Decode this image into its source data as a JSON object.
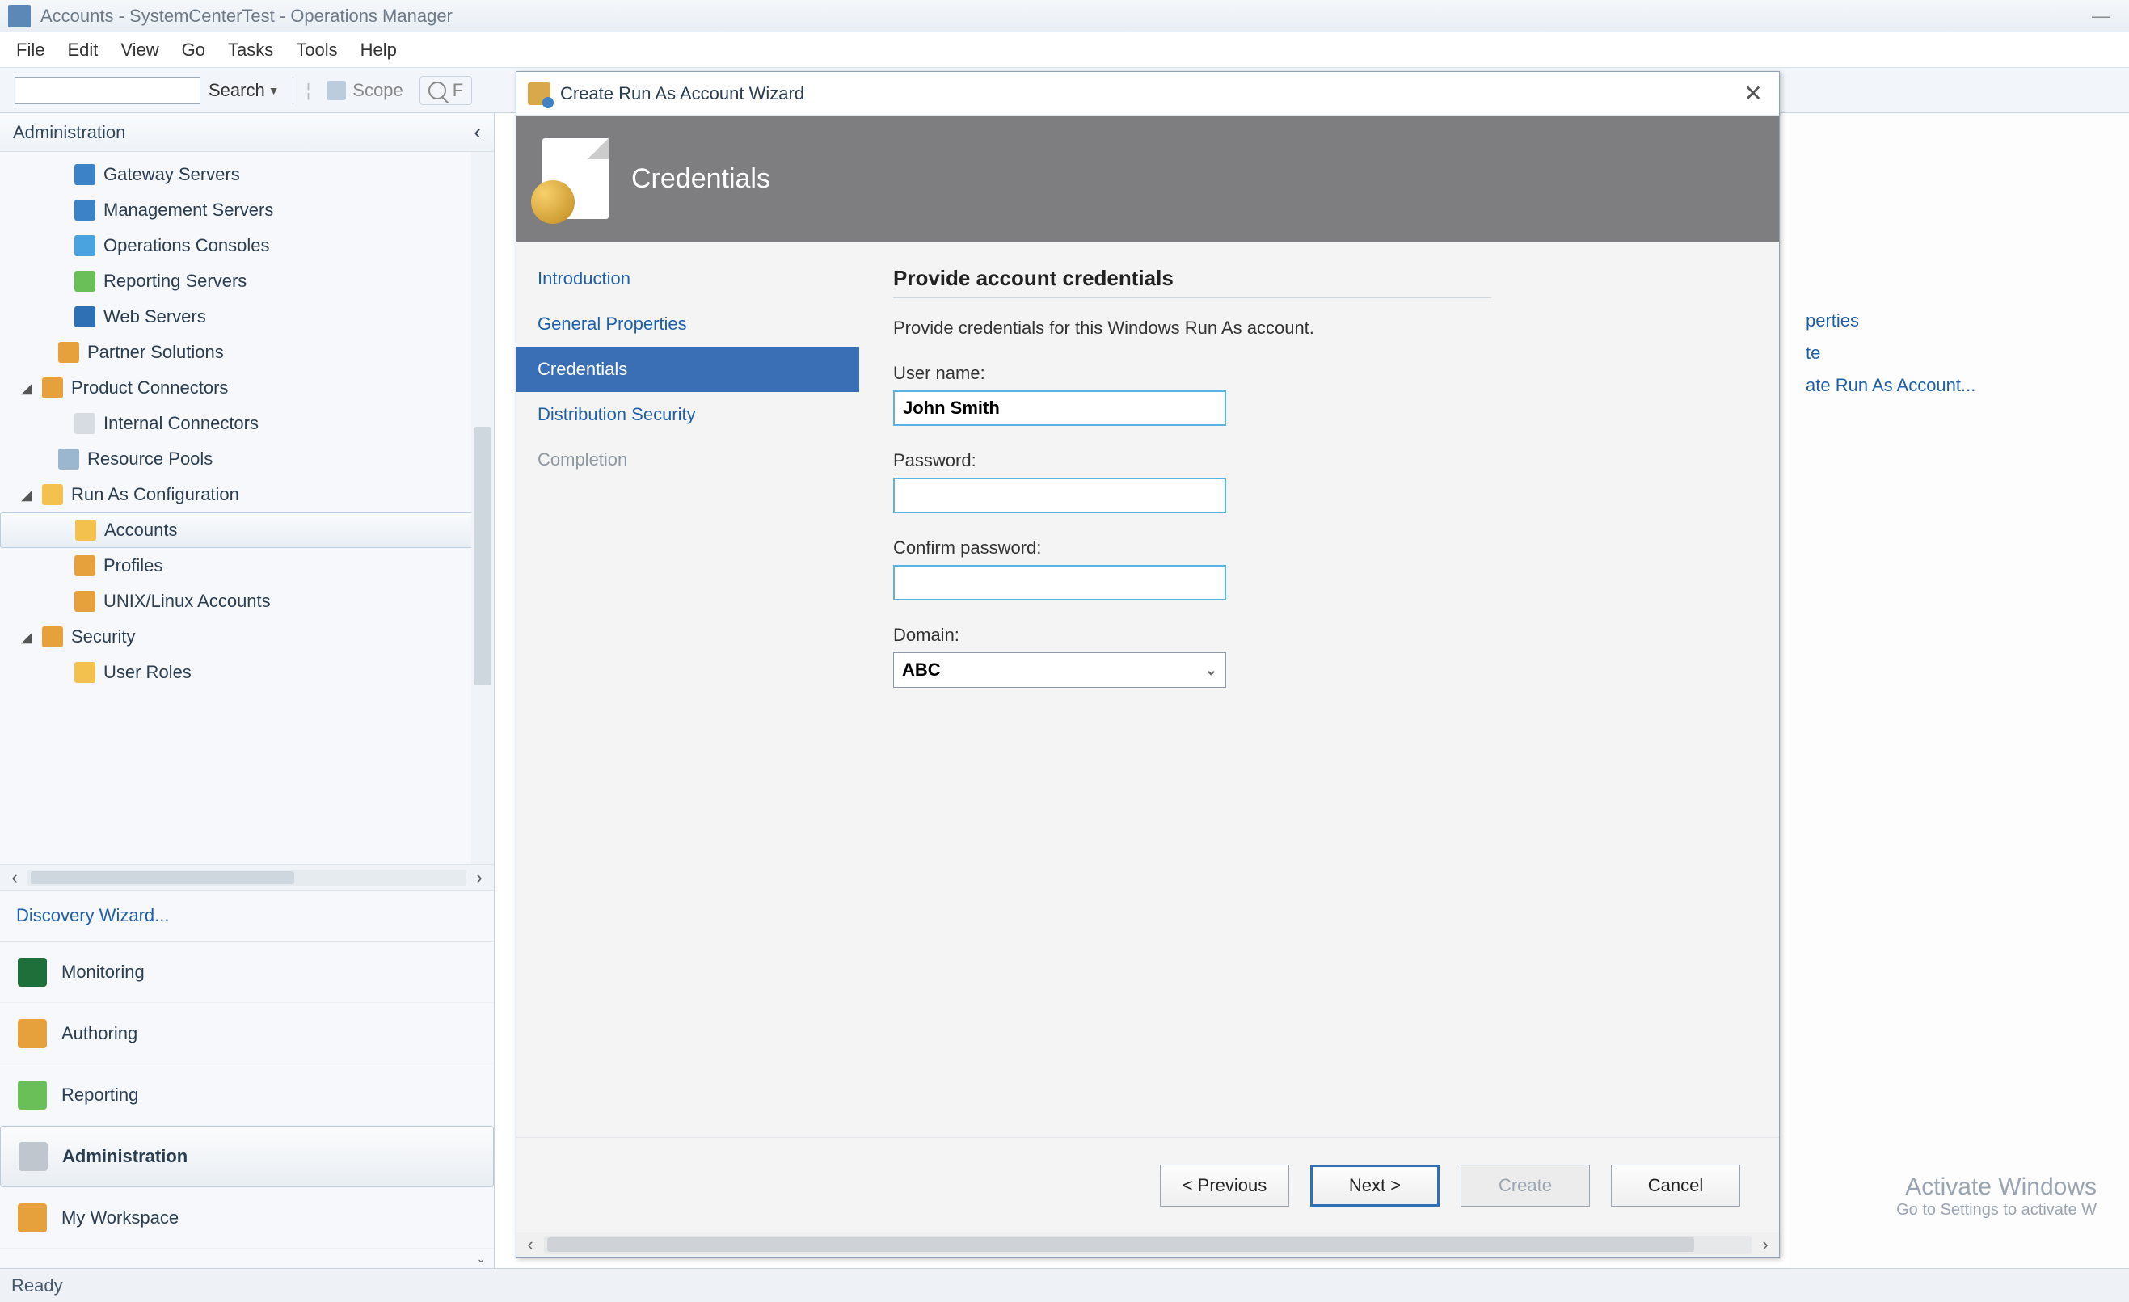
{
  "window": {
    "title": "Accounts - SystemCenterTest - Operations Manager",
    "minimize_tooltip": "—"
  },
  "menubar": [
    "File",
    "Edit",
    "View",
    "Go",
    "Tasks",
    "Tools",
    "Help"
  ],
  "toolbar": {
    "search_label": "Search",
    "scope_label": "Scope",
    "find_letter": "F"
  },
  "nav": {
    "header": "Administration",
    "collapse": "‹",
    "tree": [
      {
        "indent": 64,
        "icon": "c-srv",
        "label": "Gateway Servers"
      },
      {
        "indent": 64,
        "icon": "c-srv",
        "label": "Management Servers"
      },
      {
        "indent": 64,
        "icon": "c-cons",
        "label": "Operations Consoles"
      },
      {
        "indent": 64,
        "icon": "c-rep",
        "label": "Reporting Servers"
      },
      {
        "indent": 64,
        "icon": "c-web",
        "label": "Web Servers"
      },
      {
        "indent": 44,
        "icon": "c-part",
        "label": "Partner Solutions"
      },
      {
        "indent": 24,
        "icon": "c-conn",
        "label": "Product Connectors",
        "expander": "◢"
      },
      {
        "indent": 64,
        "icon": "c-int",
        "label": "Internal Connectors"
      },
      {
        "indent": 44,
        "icon": "c-pool",
        "label": "Resource Pools"
      },
      {
        "indent": 24,
        "icon": "c-run",
        "label": "Run As Configuration",
        "expander": "◢"
      },
      {
        "indent": 64,
        "icon": "c-acc",
        "label": "Accounts",
        "selected": true
      },
      {
        "indent": 64,
        "icon": "c-prof",
        "label": "Profiles"
      },
      {
        "indent": 64,
        "icon": "c-unix",
        "label": "UNIX/Linux Accounts"
      },
      {
        "indent": 24,
        "icon": "c-sec",
        "label": "Security",
        "expander": "◢"
      },
      {
        "indent": 64,
        "icon": "c-role",
        "label": "User Roles"
      }
    ],
    "wizard_link": "Discovery Wizard...",
    "wunderbar": [
      {
        "icon": "w-mon",
        "label": "Monitoring"
      },
      {
        "icon": "w-auth",
        "label": "Authoring"
      },
      {
        "icon": "w-rep",
        "label": "Reporting"
      },
      {
        "icon": "w-adm",
        "label": "Administration",
        "selected": true
      },
      {
        "icon": "w-my",
        "label": "My Workspace"
      }
    ]
  },
  "right_actions": {
    "items": [
      "perties",
      "te",
      "ate Run As Account..."
    ]
  },
  "dialog": {
    "title": "Create Run As Account Wizard",
    "banner_title": "Credentials",
    "steps": [
      {
        "label": "Introduction",
        "state": "link"
      },
      {
        "label": "General Properties",
        "state": "link"
      },
      {
        "label": "Credentials",
        "state": "active"
      },
      {
        "label": "Distribution Security",
        "state": "link"
      },
      {
        "label": "Completion",
        "state": "disabled"
      }
    ],
    "form": {
      "heading": "Provide account credentials",
      "description": "Provide credentials for this Windows Run As account.",
      "username_label": "User name:",
      "username_value": "John Smith",
      "password_label": "Password:",
      "password_value": "",
      "confirm_label": "Confirm password:",
      "confirm_value": "",
      "domain_label": "Domain:",
      "domain_value": "ABC"
    },
    "buttons": {
      "previous": "< Previous",
      "next": "Next >",
      "create": "Create",
      "cancel": "Cancel"
    }
  },
  "statusbar": {
    "text": "Ready"
  },
  "watermark": {
    "line1": "Activate Windows",
    "line2": "Go to Settings to activate W"
  }
}
